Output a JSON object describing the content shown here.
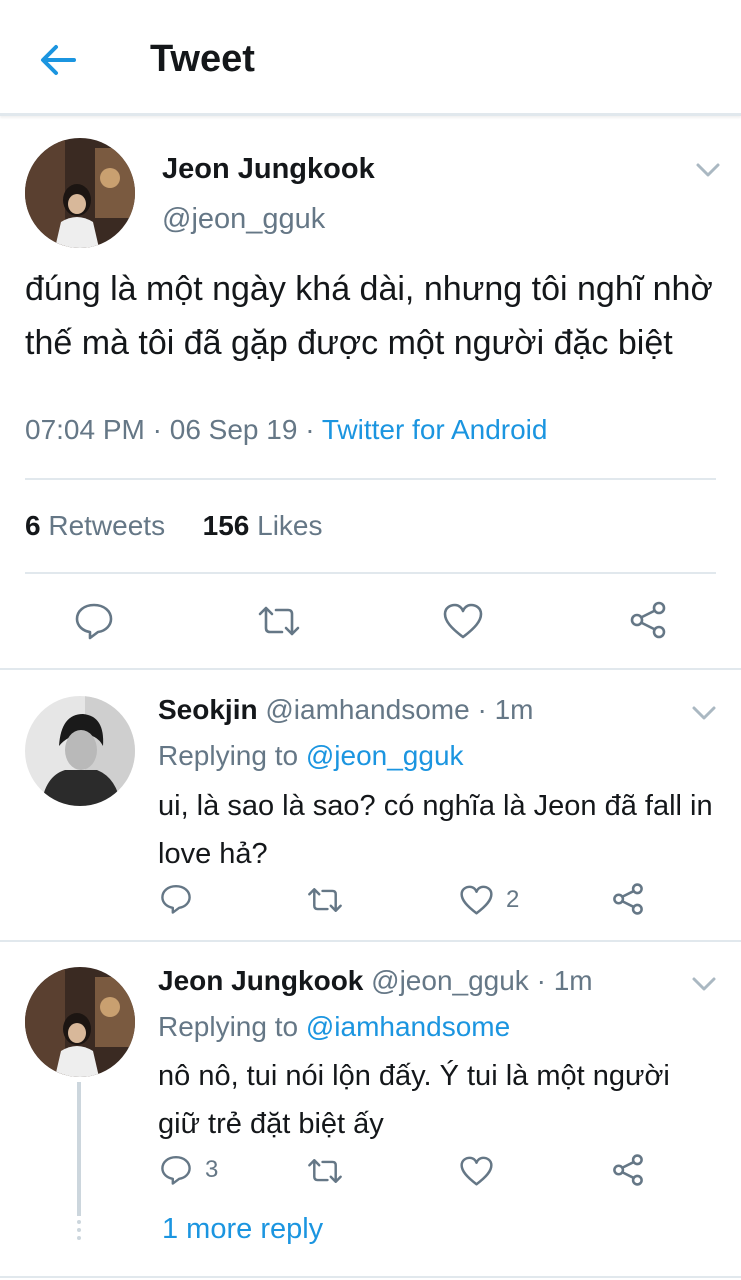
{
  "header": {
    "title": "Tweet",
    "back_icon": "arrow-left-icon",
    "accent": "#1b95e0"
  },
  "main_tweet": {
    "display_name": "Jeon Jungkook",
    "handle": "@jeon_gguk",
    "text": "đúng là một ngày khá dài, nhưng tôi nghĩ nhờ thế mà tôi đã gặp được một người đặc biệt",
    "time": "07:04 PM",
    "sep1": " · ",
    "date": "06 Sep 19",
    "sep2": " · ",
    "source": "Twitter for Android",
    "retweets_count": "6",
    "retweets_label": "Retweets",
    "likes_count": "156",
    "likes_label": "Likes",
    "actions": [
      "reply-icon",
      "retweet-icon",
      "heart-icon",
      "share-icon"
    ]
  },
  "replies": [
    {
      "display_name": "Seokjin",
      "handle": "@iamhandsome",
      "time": " · 1m",
      "replying_prefix": "Replying to ",
      "replying_to": "@jeon_gguk",
      "text": "ui, là sao là sao? có nghĩa là Jeon đã fall in love hả?",
      "reply_count": "",
      "like_count": "2"
    },
    {
      "display_name": "Jeon Jungkook",
      "handle": "@jeon_gguk",
      "time": " · 1m",
      "replying_prefix": "Replying to ",
      "replying_to": "@iamhandsome",
      "text": "nô nô, tui nói lộn đấy. Ý tui là một người giữ trẻ đặt biệt ấy",
      "reply_count": "3",
      "like_count": ""
    }
  ],
  "more_reply": "1 more reply"
}
